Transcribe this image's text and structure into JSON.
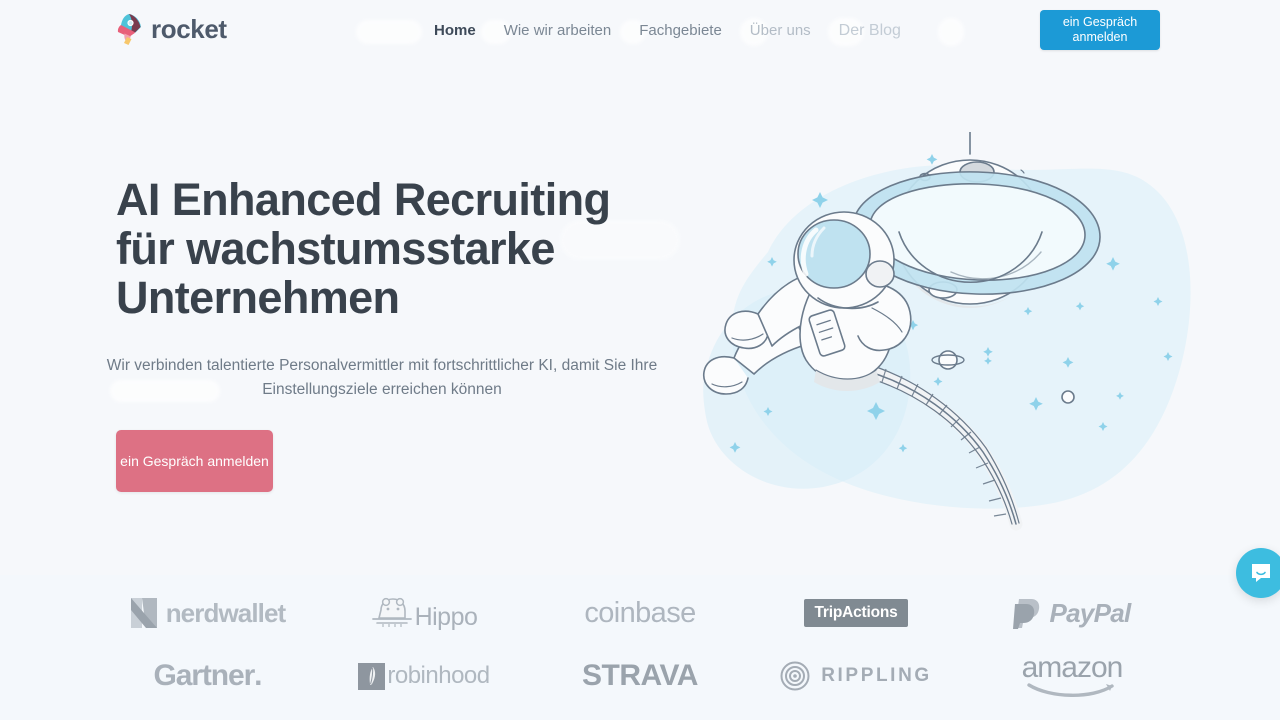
{
  "brand": {
    "name": "rocket",
    "mark_icon": "rocket-icon"
  },
  "nav": {
    "items": [
      {
        "label": "Home",
        "state": "active"
      },
      {
        "label": "Wie wir arbeiten",
        "state": "normal"
      },
      {
        "label": "Fachgebiete",
        "state": "normal"
      },
      {
        "label": "Über uns",
        "state": "faded"
      },
      {
        "label": "Der Blog",
        "state": "faded2"
      }
    ],
    "cta_label": "ein Gespräch anmelden"
  },
  "hero": {
    "title_line1": "AI Enhanced Recruiting",
    "title_line2": "für wachstumsstarke",
    "title_line3": "Unternehmen",
    "subtitle": "Wir verbinden talentierte Personalvermittler mit fortschrittlicher KI, damit Sie Ihre Einstellungsziele erreichen können",
    "cta_label": "ein Gespräch anmelden",
    "illustration_icon": "astronaut-planet-illustration"
  },
  "logos": {
    "row1": [
      {
        "name": "nerdwallet",
        "label": "nerdwallet",
        "icon": "nerdwallet-mark-icon"
      },
      {
        "name": "hippo",
        "label": "Hippo",
        "icon": "hippo-mark-icon"
      },
      {
        "name": "coinbase",
        "label": "coinbase",
        "icon": ""
      },
      {
        "name": "tripactions",
        "label": "TripActions",
        "icon": ""
      },
      {
        "name": "paypal",
        "label": "PayPal",
        "icon": "paypal-mark-icon"
      }
    ],
    "row2": [
      {
        "name": "gartner",
        "label": "Gartner",
        "icon": ""
      },
      {
        "name": "robinhood",
        "label": "robinhood",
        "icon": "robinhood-mark-icon"
      },
      {
        "name": "strava",
        "label": "STRAVA",
        "icon": ""
      },
      {
        "name": "rippling",
        "label": "RIPPLING",
        "icon": "rippling-mark-icon"
      },
      {
        "name": "amazon",
        "label": "amazon",
        "icon": "amazon-smile-icon"
      }
    ]
  },
  "chat": {
    "icon": "chat-bubble-icon"
  },
  "colors": {
    "page_bg": "#f6f8fb",
    "logos_bg": "#f4f8fc",
    "header_cta_bg": "#1c9ad6",
    "hero_cta_bg": "#dd7184",
    "heading_text": "#39424c",
    "body_text": "#6f7b88",
    "chat_bg": "#3dbde0",
    "illustration_blob": "#d9eef7"
  }
}
